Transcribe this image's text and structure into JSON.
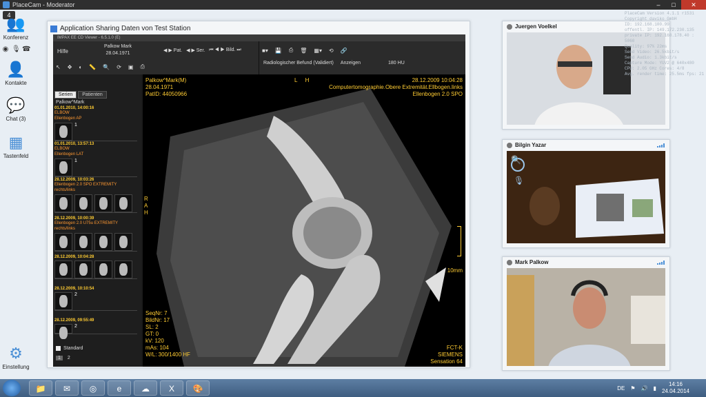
{
  "app": {
    "title": "PlaceCam - Moderator"
  },
  "rail": {
    "badge": "4",
    "konferenz": "Konferenz",
    "kontakte": "Kontakte",
    "chat": "Chat (3)",
    "tastenfeld": "Tastenfeld",
    "einstellung": "Einstellung"
  },
  "share": {
    "title": "Application Sharing Daten von Test Station",
    "impax_title": "IMPAX EE CD Viewer - 6.5.1.0 (E)",
    "hilfe": "Hilfe",
    "patient_name": "Palkow Mark",
    "patient_dob": "28.04.1971",
    "nav": [
      "Pat.",
      "Ser.",
      "Bild."
    ],
    "befund": "Radiologischer Befund (Validiert)",
    "anzeigen": "Anzeigen",
    "hu": "180 HU",
    "tabs": [
      "Serien",
      "Patienten"
    ],
    "patient_label": "Palkow^Mark",
    "series": [
      {
        "date": "01.01.2010, 14:00:16",
        "desc": "ELBOW\nEllenbogen AP",
        "count": "1"
      },
      {
        "date": "01.01.2010, 13:57:13",
        "desc": "ELBOW\nEllenbogen LAT",
        "count": "1"
      },
      {
        "date": "28.12.2009, 10:03:26",
        "desc": "Ellenbogen 2.0 SPO EXTREMITY\nrechts/links",
        "count": "29"
      },
      {
        "date": "28.12.2009, 10:00:39",
        "desc": "Ellenbogen 2.0 U75u EXTREMITY\nrechts/links",
        "count": "42"
      },
      {
        "date": "28.12.2009, 10:04:28",
        "desc": "",
        "count": "40"
      },
      {
        "date": "28.12.2009, 10:10:54",
        "desc": "",
        "count": "2"
      },
      {
        "date": "28.12.2009, 09:55:49",
        "desc": "",
        "count": "2"
      }
    ],
    "standard": "Standard",
    "pages": [
      "1",
      "2"
    ]
  },
  "viewer": {
    "tl": [
      "Palkow^Mark(M)",
      "28.04.1971",
      "PatID: 44050966"
    ],
    "tr": [
      "28.12.2009 10:04:28",
      "Computertomographie.Obere Extremität.Ellbogen.links",
      "Ellenbogen  2.0  SPO"
    ],
    "bl": [
      "SeqNr: 7",
      "BildNr: 17",
      "SL: 2",
      "GT: 0",
      "kV: 120",
      "mAs: 104",
      "W/L: 300/1400 HF"
    ],
    "br": [
      "FCT-K",
      "SIEMENS",
      "Sensation 64"
    ],
    "orient_top": [
      "L",
      "H"
    ],
    "orient_left": [
      "R",
      "A",
      "H"
    ],
    "scale_label": "10mm"
  },
  "videos": [
    {
      "name": "Juergen Voelkel"
    },
    {
      "name": "Bilgin Yazar"
    },
    {
      "name": "Mark Palkow"
    }
  ],
  "overlay": [
    "PlaceCam Version 4.1.1 r1531",
    "Copyright daviko GmbH",
    "ID: 192.168.100.99",
    "offentl. IP: 149.172.230.135",
    "private IP: 192.168.178.40 : 5060",
    "Quality: 97% 22ms",
    "Send Video: 26.5kbit/s",
    "Send Audio: 1.3kbit/s",
    "Capture Mode: YUV2 @ 640x480",
    "CPU: 2.05 GHz  Cores: 4/8",
    "Avg. render time: 25.5ms  fps: 21"
  ],
  "taskbar": {
    "lang": "DE",
    "time": "14:16",
    "date": "24.04.2014"
  }
}
